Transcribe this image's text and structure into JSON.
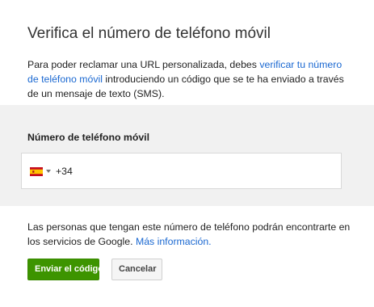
{
  "dialog": {
    "title": "Verifica el número de teléfono móvil",
    "intro_before": "Para poder reclamar una URL personalizada, debes ",
    "intro_link": "verificar tu número de teléfono móvil",
    "intro_after": " introduciendo un código que se te ha enviado a través de un mensaje de texto (SMS)."
  },
  "phone": {
    "label": "Número de teléfono móvil",
    "country_flag": "spain-flag",
    "country_code": "+34",
    "value": "",
    "placeholder": ""
  },
  "note": {
    "text": "Las personas que tengan este número de teléfono podrán encontrarte en los servicios de Google. ",
    "link": "Más información."
  },
  "actions": {
    "send_label": "Enviar el código",
    "cancel_label": "Cancelar"
  },
  "colors": {
    "link": "#1a68d1",
    "primary_button": "#3d9400",
    "section_background": "#f1f1f1"
  }
}
